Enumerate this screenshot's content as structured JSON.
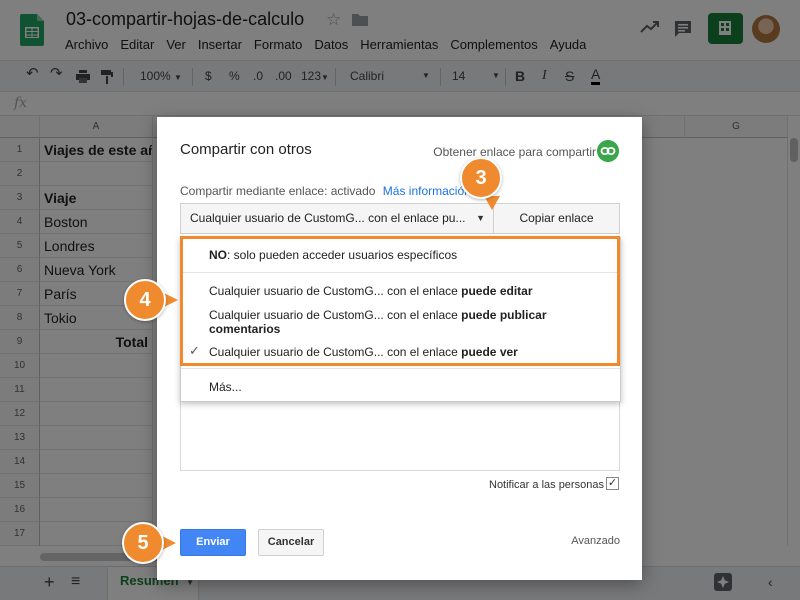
{
  "header": {
    "doc_title": "03-compartir-hojas-de-calculo",
    "menu": [
      "Archivo",
      "Editar",
      "Ver",
      "Insertar",
      "Formato",
      "Datos",
      "Herramientas",
      "Complementos",
      "Ayuda"
    ]
  },
  "toolbar": {
    "zoom": "100%",
    "currency": "$",
    "percent": "%",
    "dec_less": ".0",
    "dec_more": ".00",
    "more_formats": "123",
    "font": "Calibri",
    "font_size": "14",
    "bold": "B",
    "italic": "I",
    "strike": "S",
    "text_color": "A"
  },
  "formula_bar": {
    "fx": "fx"
  },
  "grid": {
    "columns": [
      "A",
      "G"
    ],
    "rows": [
      "1",
      "2",
      "3",
      "4",
      "5",
      "6",
      "7",
      "8",
      "9",
      "10",
      "11",
      "12",
      "13",
      "14",
      "15",
      "16",
      "17"
    ],
    "cells": {
      "a1": "Viajes de este añ",
      "a3": "Viaje",
      "a4": "Boston",
      "a5": "Londres",
      "a6": "Nueva York",
      "a7": "París",
      "a8": "Tokio",
      "a9": "Total"
    }
  },
  "sheets": {
    "active_tab": "Resumen"
  },
  "dialog": {
    "title": "Compartir con otros",
    "get_link": "Obtener enlace para compartir",
    "link_status": "Compartir mediante enlace: activado",
    "more_info": "Más información",
    "access_select": "Cualquier usuario de CustomG...  con el enlace pu...",
    "copy_link": "Copiar enlace",
    "notify": "Notificar a las personas",
    "send": "Enviar",
    "cancel": "Cancelar",
    "advanced": "Avanzado"
  },
  "dropdown": {
    "no_prefix": "NO",
    "no_rest": ": solo pueden acceder usuarios específicos",
    "edit_a": "Cualquier usuario de CustomG...  con el enlace ",
    "edit_b": "puede editar",
    "comment_a": "Cualquier usuario de CustomG...  con el enlace ",
    "comment_b": "puede publicar",
    "comment_c": "comentarios",
    "view_a": "Cualquier usuario de CustomG...  con el enlace ",
    "view_b": "puede ver",
    "more": "Más..."
  },
  "callouts": [
    "3",
    "4",
    "5"
  ],
  "colors": {
    "accent": "#ef8a2f",
    "sheets_green": "#188038",
    "primary_button": "#4285f4"
  }
}
